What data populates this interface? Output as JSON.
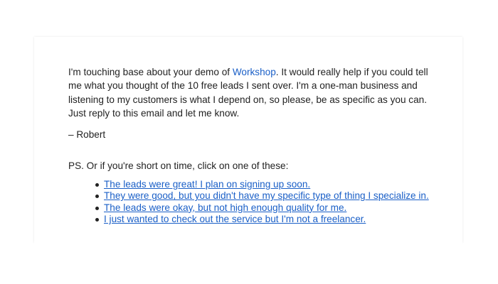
{
  "email": {
    "intro_before_link": "I'm touching base about your demo of ",
    "product_link": "Workshop",
    "intro_after_link": ". It would really help if you could tell me what you thought of the 10 free leads I sent over. I'm a one-man business and listening to my customers is what I depend on, so please, be as specific as you can. Just reply to this email and let me know.",
    "signature": "– Robert",
    "ps_text": "PS. Or if you're short on time, click on one of these:",
    "options": [
      "The leads were great! I plan on signing up soon.",
      "They were good, but you didn't have my specific type of thing I specialize in.",
      "The leads were okay, but not high enough quality for me.",
      "I just wanted to check out the service but I'm not a freelancer."
    ]
  },
  "colors": {
    "link": "#1a5fc7",
    "text": "#222222"
  }
}
